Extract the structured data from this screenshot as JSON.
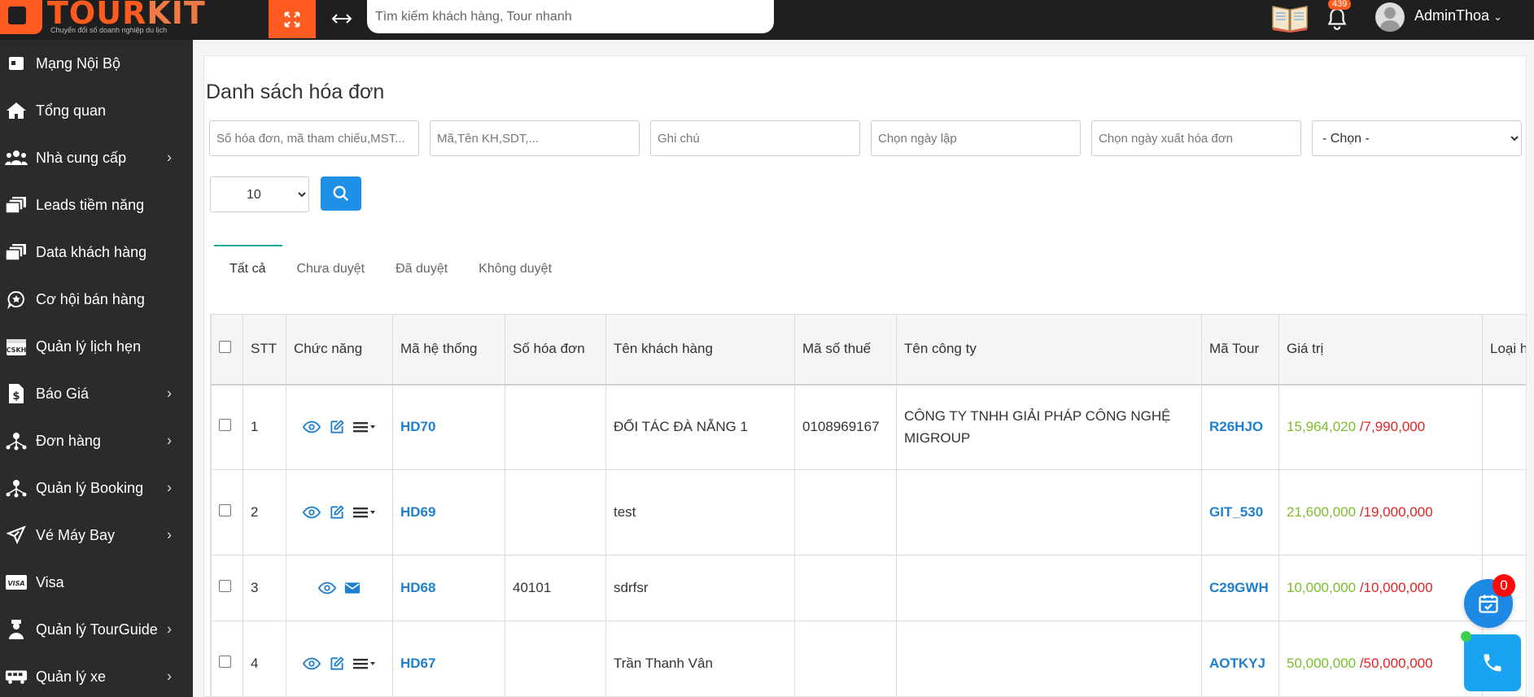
{
  "topbar": {
    "logo_main": "TOUR",
    "logo_accent": "KIT",
    "logo_tagline": "Chuyển đổi số doanh nghiệp du lịch",
    "search_placeholder": "Tìm kiếm khách hàng, Tour nhanh",
    "notification_count": "439",
    "username": "AdminThoa",
    "accent_color": "#ff5a1f"
  },
  "sidebar": {
    "items": [
      {
        "label": "Mạng Nội Bộ",
        "icon": "intranet-icon",
        "has_children": false
      },
      {
        "label": "Tổng quan",
        "icon": "home-icon",
        "has_children": false
      },
      {
        "label": "Nhà cung cấp",
        "icon": "users-icon",
        "has_children": true
      },
      {
        "label": "Leads tiềm năng",
        "icon": "stack-icon",
        "has_children": false
      },
      {
        "label": "Data khách hàng",
        "icon": "stack-icon",
        "has_children": false
      },
      {
        "label": "Cơ hội bán hàng",
        "icon": "star-chat-icon",
        "has_children": false
      },
      {
        "label": "Quản lý lịch hẹn",
        "icon": "calendar-cskh-icon",
        "has_children": false
      },
      {
        "label": "Báo Giá",
        "icon": "dollar-file-icon",
        "has_children": true
      },
      {
        "label": "Đơn hàng",
        "icon": "network-icon",
        "has_children": true
      },
      {
        "label": "Quản lý Booking",
        "icon": "network-icon",
        "has_children": true
      },
      {
        "label": "Vé Máy Bay",
        "icon": "plane-icon",
        "has_children": true
      },
      {
        "label": "Visa",
        "icon": "visa-icon",
        "has_children": false
      },
      {
        "label": "Quản lý TourGuide",
        "icon": "guide-icon",
        "has_children": true
      },
      {
        "label": "Quản lý xe",
        "icon": "bus-icon",
        "has_children": true
      }
    ]
  },
  "main": {
    "title": "Danh sách hóa đơn",
    "filters": {
      "invoice_placeholder": "Số hóa đơn, mã tham chiếu,MST...",
      "customer_placeholder": "Mã,Tên KH,SDT,...",
      "note_placeholder": "Ghi chú",
      "created_date_placeholder": "Chọn ngày lập",
      "export_date_placeholder": "Chọn ngày xuất hóa đơn",
      "select_value": "- Chọn -",
      "page_size": "10"
    },
    "tabs": [
      "Tất cả",
      "Chưa duyệt",
      "Đã duyệt",
      "Không duyệt"
    ],
    "table": {
      "columns": [
        "STT",
        "Chức năng",
        "Mã hệ thống",
        "Số hóa đơn",
        "Tên khách hàng",
        "Mã số thuế",
        "Tên công ty",
        "Mã Tour",
        "Giá trị",
        "Loại h"
      ],
      "rows": [
        {
          "stt": "1",
          "code": "HD70",
          "invoice_no": "",
          "customer": "ĐỐI TÁC ĐÀ NẴNG 1",
          "tax": "0108969167",
          "company": "CÔNG TY TNHH GIẢI PHÁP CÔNG NGHỆ MIGROUP",
          "tour": "R26HJO",
          "value_a": "15,964,020",
          "value_b": "/7,990,000",
          "actions": "view-edit-menu"
        },
        {
          "stt": "2",
          "code": "HD69",
          "invoice_no": "",
          "customer": "test",
          "tax": "",
          "company": "",
          "tour": "GIT_530",
          "value_a": "21,600,000",
          "value_b": "/19,000,000",
          "actions": "view-edit-menu"
        },
        {
          "stt": "3",
          "code": "HD68",
          "invoice_no": "40101",
          "customer": "sdrfsr",
          "tax": "",
          "company": "",
          "tour": "C29GWH",
          "value_a": "10,000,000",
          "value_b": "/10,000,000",
          "actions": "view-mail"
        },
        {
          "stt": "4",
          "code": "HD67",
          "invoice_no": "",
          "customer": "Trần Thanh Vân",
          "tax": "",
          "company": "",
          "tour": "AOTKYJ",
          "value_a": "50,000,000",
          "value_b": "/50,000,000",
          "actions": "view-edit-menu"
        }
      ]
    }
  },
  "floating": {
    "calendar_badge": "0"
  }
}
